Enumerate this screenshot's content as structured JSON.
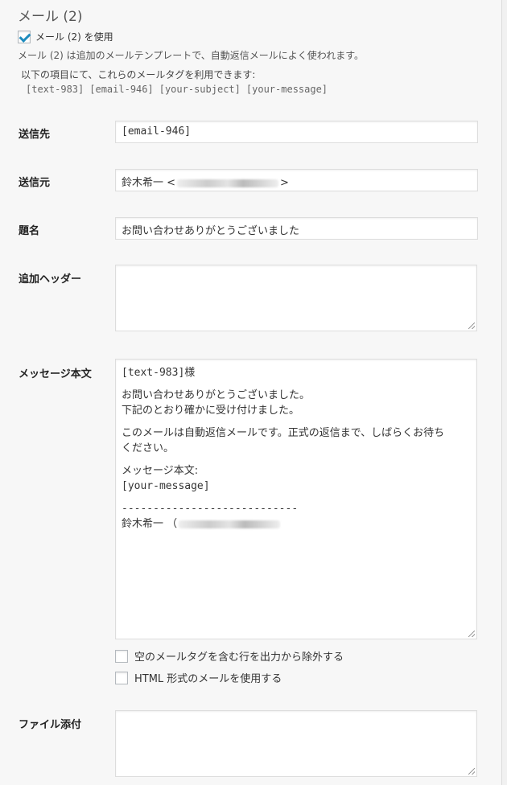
{
  "mail2": {
    "title": "メール (2)",
    "enable_label": "メール (2) を使用",
    "description": "メール (2) は追加のメールテンプレートで、自動返信メールによく使われます。",
    "tag_intro": "以下の項目にて、これらのメールタグを利用できます:",
    "tags": [
      "[text-983]",
      "[email-946]",
      "[your-subject]",
      "[your-message]"
    ]
  },
  "fields": {
    "to_label": "送信先",
    "to_value": "[email-946]",
    "from_label": "送信元",
    "from_value_prefix": "鈴木希一 <",
    "from_value_suffix": ">",
    "subject_label": "題名",
    "subject_value": "お問い合わせありがとうございました",
    "headers_label": "追加ヘッダー",
    "body_label": "メッセージ本文",
    "body_lines": [
      "[text-983]様",
      "",
      "お問い合わせありがとうございました。",
      "下記のとおり確かに受け付けました。",
      "",
      "このメールは自動返信メールです。正式の返信まで、しばらくお待ち",
      "ください。",
      "",
      "メッセージ本文:",
      "[your-message]",
      "",
      "----------------------------",
      "鈴木希一 （"
    ],
    "attachments_label": "ファイル添付"
  },
  "options": {
    "exclude_blank_label": "空のメールタグを含む行を出力から除外する",
    "use_html_label": "HTML 形式のメールを使用する"
  }
}
